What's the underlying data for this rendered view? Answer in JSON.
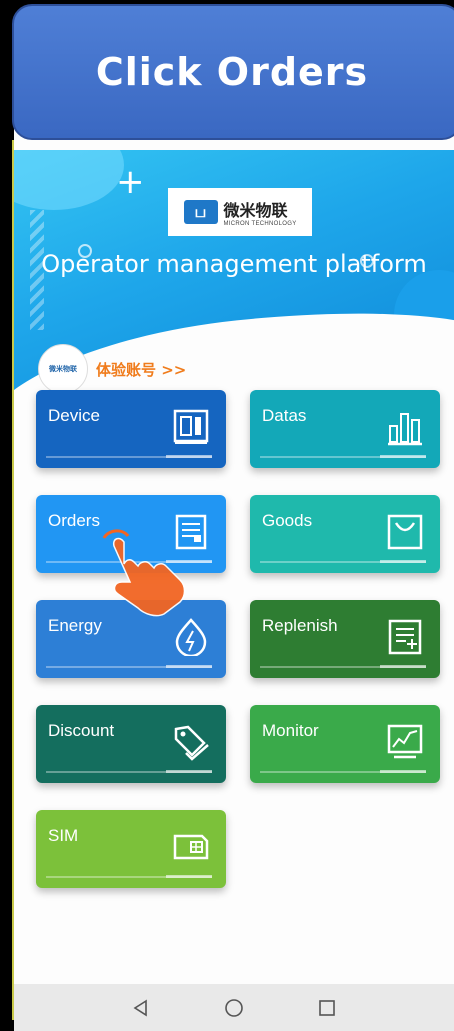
{
  "instruction": {
    "title": "Click Orders"
  },
  "header": {
    "logo_mark": "ப",
    "logo_cn": "微米物联",
    "logo_en": "MICRON TECHNOLOGY",
    "platform_title": "Operator management platform",
    "avatar_text": "微米物联",
    "account_link": "体验账号 >>"
  },
  "tiles": [
    {
      "label": "Device",
      "icon": "device-panel-icon",
      "color": "#1565c0"
    },
    {
      "label": "Datas",
      "icon": "bar-chart-icon",
      "color": "#13a8b8"
    },
    {
      "label": "Orders",
      "icon": "orders-list-icon",
      "color": "#2196f3"
    },
    {
      "label": "Goods",
      "icon": "goods-basket-icon",
      "color": "#1fb9ac"
    },
    {
      "label": "Energy",
      "icon": "energy-bolt-icon",
      "color": "#2d7fd6"
    },
    {
      "label": "Replenish",
      "icon": "replenish-list-icon",
      "color": "#2e7d32"
    },
    {
      "label": "Discount",
      "icon": "discount-tags-icon",
      "color": "#146e5e"
    },
    {
      "label": "Monitor",
      "icon": "monitor-chart-icon",
      "color": "#3aaa4a"
    },
    {
      "label": "SIM",
      "icon": "sim-card-icon",
      "color": "#7cc13a"
    }
  ],
  "navbar": {
    "back": "back-triangle-icon",
    "home": "home-circle-icon",
    "recents": "recents-square-icon"
  }
}
